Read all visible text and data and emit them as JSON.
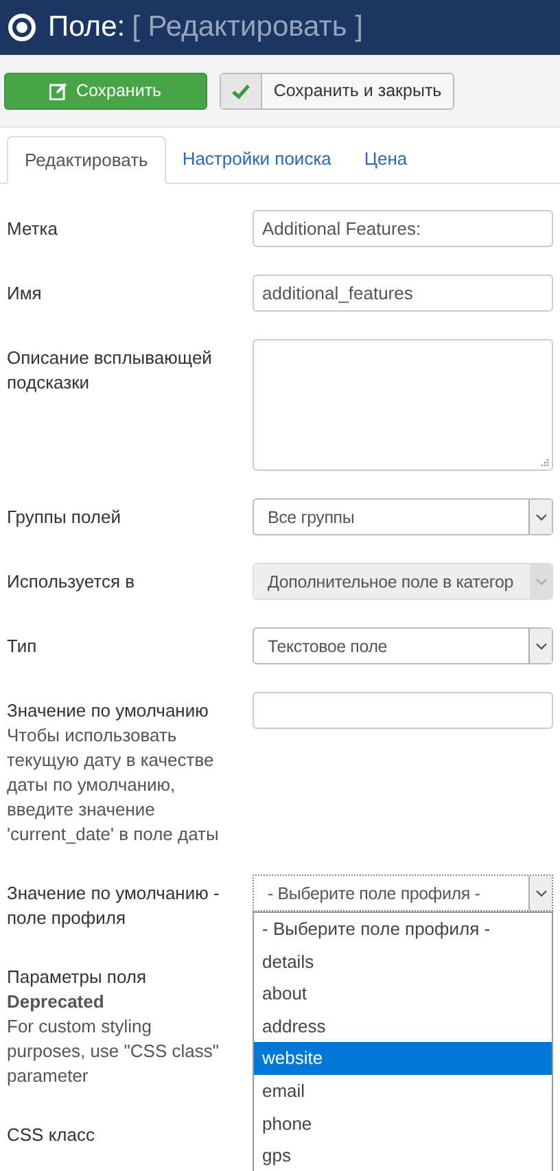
{
  "header": {
    "title": "Поле:",
    "subtitle": "[ Редактировать ]"
  },
  "toolbar": {
    "buttons": [
      {
        "kind": "primary",
        "label": "Сохранить"
      },
      {
        "kind": "check",
        "label": "Сохранить и закрыть"
      }
    ]
  },
  "tabs": [
    {
      "label": "Редактировать",
      "selected": true
    },
    {
      "label": "Настройки поиска",
      "selected": false
    },
    {
      "label": "Цена",
      "selected": false
    }
  ],
  "fields": [
    {
      "label": "Метка",
      "kind": "text",
      "value": "Additional Features:"
    },
    {
      "label": "Имя",
      "kind": "text",
      "value": "additional_features"
    },
    {
      "label": "Описание всплывающей подсказки",
      "kind": "textarea"
    },
    {
      "label": "Группы полей",
      "kind": "select",
      "value": "Все группы",
      "disabled": false
    },
    {
      "label": "Используется в",
      "kind": "select",
      "value": "Дополнительное поле в категор",
      "disabled": true
    },
    {
      "label": "Тип",
      "kind": "select",
      "value": "Текстовое поле",
      "disabled": false
    },
    {
      "label": "Значение по умолчанию",
      "description": "Чтобы использовать текущую дату в качестве даты по умолчанию, введите значение 'current_date' в поле даты",
      "kind": "text"
    },
    {
      "label": "Значение по умолчанию - поле профиля",
      "kind": "dropdown",
      "value": "- Выберите поле профиля -",
      "options": [
        {
          "label": "- Выберите поле профиля -",
          "highlighted": false
        },
        {
          "label": "details",
          "highlighted": false
        },
        {
          "label": "about",
          "highlighted": false
        },
        {
          "label": "address",
          "highlighted": false
        },
        {
          "label": "website",
          "highlighted": true
        },
        {
          "label": "email",
          "highlighted": false
        },
        {
          "label": "phone",
          "highlighted": false
        },
        {
          "label": "gps",
          "highlighted": false
        }
      ]
    },
    {
      "label": "Параметры поля",
      "note": "Deprecated",
      "description": "For custom styling purposes, use \"CSS class\" parameter",
      "kind": "none"
    },
    {
      "label": "CSS класс",
      "kind": "none"
    }
  ]
}
